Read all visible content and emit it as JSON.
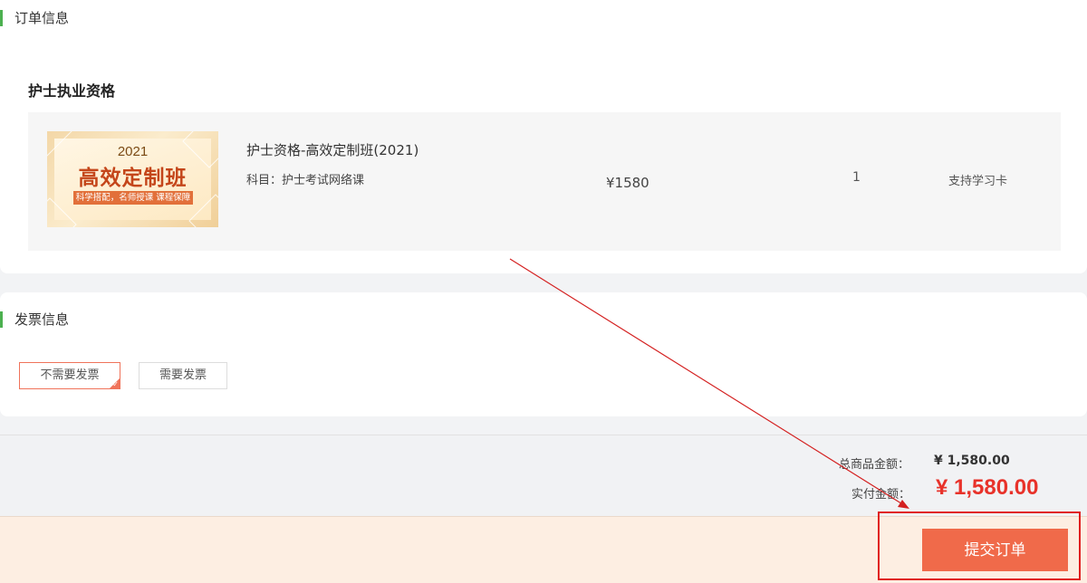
{
  "order": {
    "section_title": "订单信息",
    "category_title": "护士执业资格",
    "product": {
      "thumb_year": "2021",
      "thumb_name": "高效定制班",
      "thumb_tag": "科学搭配，名师授课 课程保障",
      "name": "护士资格-高效定制班(2021)",
      "subject": "科目：护士考试网络课",
      "price": "¥1580",
      "quantity": "1",
      "study_card": "支持学习卡"
    }
  },
  "invoice": {
    "section_title": "发票信息",
    "option_no": "不需要发票",
    "option_yes": "需要发票",
    "selected": "不需要发票"
  },
  "summary": {
    "total_label": "总商品金额：",
    "total_value": "¥ 1,580.00",
    "paid_label": "实付金额：",
    "paid_value": "¥ 1,580.00"
  },
  "submit": {
    "button_label": "提交订单"
  },
  "colors": {
    "accent_green": "#4cb050",
    "submit_orange": "#f06a4a",
    "price_red": "#e8322a",
    "annotation_red": "#e02020"
  }
}
